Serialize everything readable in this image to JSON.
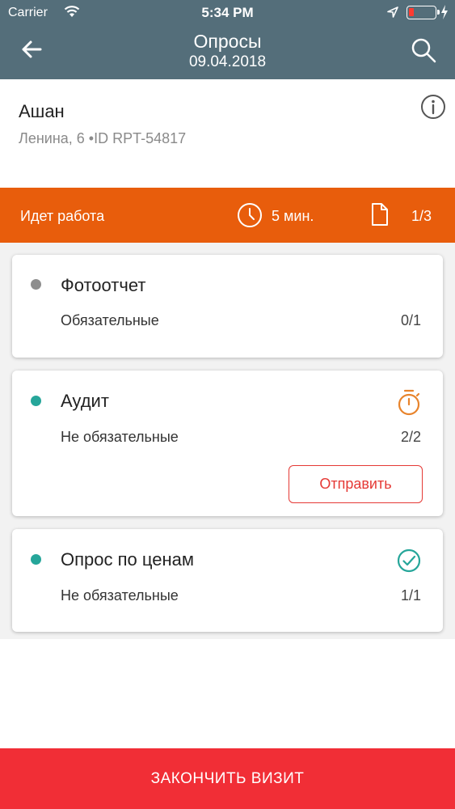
{
  "status_bar": {
    "carrier": "Carrier",
    "time": "5:34 PM"
  },
  "header": {
    "title": "Опросы",
    "date": "09.04.2018"
  },
  "store": {
    "name": "Ашан",
    "address": "Ленина, 6 •ID RPT-54817"
  },
  "work_bar": {
    "status": "Идет работа",
    "duration": "5 мин.",
    "pages": "1/3"
  },
  "surveys": [
    {
      "title": "Фотоотчет",
      "requirement": "Обязательные",
      "count": "0/1",
      "dot_color": "#8e8e8e",
      "icon": null
    },
    {
      "title": "Аудит",
      "requirement": "Не обязательные",
      "count": "2/2",
      "dot_color": "#26a69a",
      "icon": "stopwatch-icon",
      "action": "Отправить"
    },
    {
      "title": "Опрос по ценам",
      "requirement": "Не обязательные",
      "count": "1/1",
      "dot_color": "#26a69a",
      "icon": "check-circle-icon"
    }
  ],
  "finish_button": "ЗАКОНЧИТЬ ВИЗИТ",
  "colors": {
    "header": "#546e7a",
    "work_bar": "#e85d0c",
    "finish": "#f12e36",
    "accent_red": "#e53935",
    "teal": "#26a69a"
  }
}
